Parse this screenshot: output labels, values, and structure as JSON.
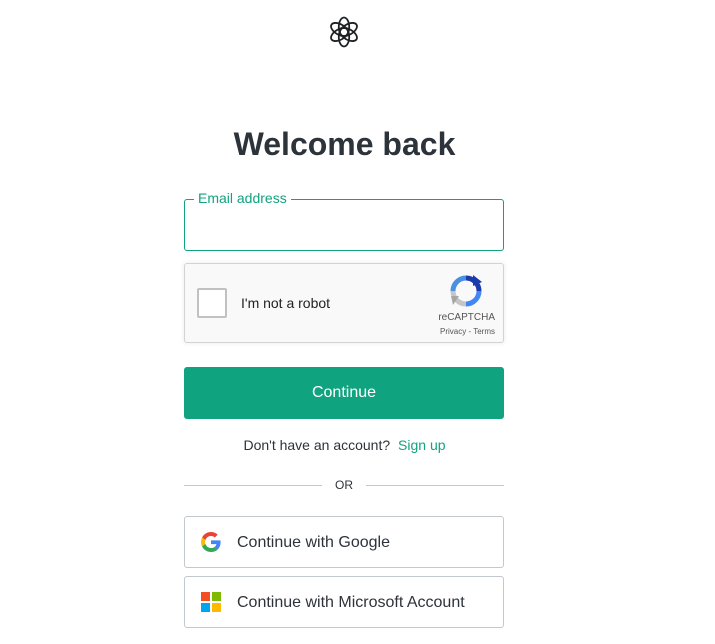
{
  "title": "Welcome back",
  "email": {
    "label": "Email address",
    "value": "",
    "placeholder": ""
  },
  "captcha": {
    "checkbox_label": "I'm not a robot",
    "brand": "reCAPTCHA",
    "privacy": "Privacy",
    "separator": " - ",
    "terms": "Terms"
  },
  "continue_label": "Continue",
  "signup": {
    "prompt": "Don't have an account?",
    "link": "Sign up"
  },
  "divider_text": "OR",
  "social": {
    "google_label": "Continue with Google",
    "microsoft_label": "Continue with Microsoft Account"
  },
  "colors": {
    "accent": "#10a37f",
    "text": "#2d333a",
    "border": "#c2c8d0"
  },
  "icons": {
    "logo": "openai-logo-icon",
    "recaptcha": "recaptcha-icon",
    "google": "google-icon",
    "microsoft": "microsoft-icon"
  }
}
